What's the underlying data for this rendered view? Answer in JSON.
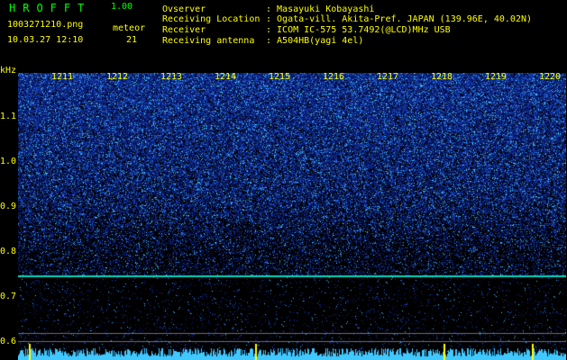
{
  "app": {
    "name": "HROFFT",
    "version": "1.00"
  },
  "file": {
    "name": "1003271210.png",
    "datetime": "10.03.27 12:10"
  },
  "detection": {
    "label": "meteor",
    "count": "21"
  },
  "info": [
    {
      "key": "Ovserver",
      "value": ": Masayuki Kobayashi"
    },
    {
      "key": "Receiving Location",
      "value": ": Ogata-vill. Akita-Pref. JAPAN (139.96E, 40.02N)"
    },
    {
      "key": "Receiver",
      "value": ": ICOM IC-575 53.7492(@LCD)MHz USB"
    },
    {
      "key": "Receiving antenna",
      "value": ": A504HB(yagi 4el)"
    }
  ],
  "spectrogram": {
    "y_unit": "kHz",
    "y_ticks": [
      "1.1",
      "1.0",
      "0.9",
      "0.8",
      "0.7",
      "0.6"
    ],
    "x_ticks": [
      "1211",
      "1212",
      "1213",
      "1214",
      "1215",
      "1216",
      "1217",
      "1218",
      "1219",
      "1220"
    ],
    "colors": {
      "text": "#ffff00",
      "title": "#00ff00",
      "noise_low": "#0a1a6e",
      "noise_high": "#4fd4ff",
      "carrier": "#00d8c0"
    }
  }
}
